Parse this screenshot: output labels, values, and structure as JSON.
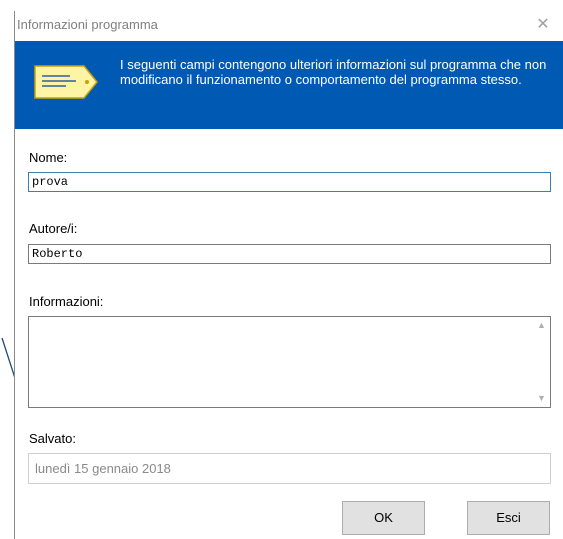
{
  "window": {
    "title": "Informazioni programma",
    "close_icon": "close-icon"
  },
  "banner": {
    "icon": "tag-icon",
    "text": "I seguenti campi contengono ulteriori informazioni sul programma che non modificano il funzionamento o comportamento del programma stesso."
  },
  "fields": {
    "nome_label": "Nome:",
    "nome_value": "prova",
    "autore_label": "Autore/i:",
    "autore_value": "Roberto",
    "informazioni_label": "Informazioni:",
    "informazioni_value": "",
    "salvato_label": "Salvato:",
    "salvato_value": "lunedì 15 gennaio 2018"
  },
  "buttons": {
    "ok": "OK",
    "esci": "Esci"
  },
  "colors": {
    "banner": "#0059b3",
    "tag_fill": "#fff3a6",
    "focus_border": "#3c7fb1"
  }
}
